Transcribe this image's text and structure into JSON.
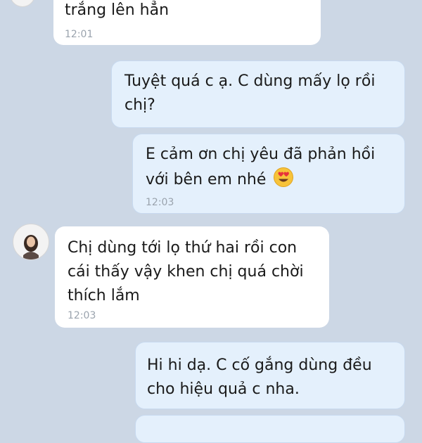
{
  "messages": [
    {
      "side": "received",
      "text": "trắng lên hẳn",
      "time": "12:01"
    },
    {
      "side": "sent",
      "text": "Tuyệt quá c ạ. C dùng mấy lọ rồi\nchị?",
      "time": ""
    },
    {
      "side": "sent",
      "text": "E cảm ơn chị yêu đã phản hồi\nvới bên em nhé",
      "emoji": "heart-eyes-emoji",
      "time": "12:03"
    },
    {
      "side": "received",
      "text": "Chị dùng tới lọ thứ hai rồi con\ncái thấy vậy khen chị quá chời\nthích lắm",
      "time": "12:03"
    },
    {
      "side": "sent",
      "text": "Hi hi dạ. C cố gắng dùng đều\ncho hiệu quả c nha.",
      "time": ""
    }
  ],
  "colors": {
    "background": "#ccd7e5",
    "received_bubble": "#ffffff",
    "sent_bubble": "#e4f0fc",
    "timestamp": "#9aa3ad"
  }
}
